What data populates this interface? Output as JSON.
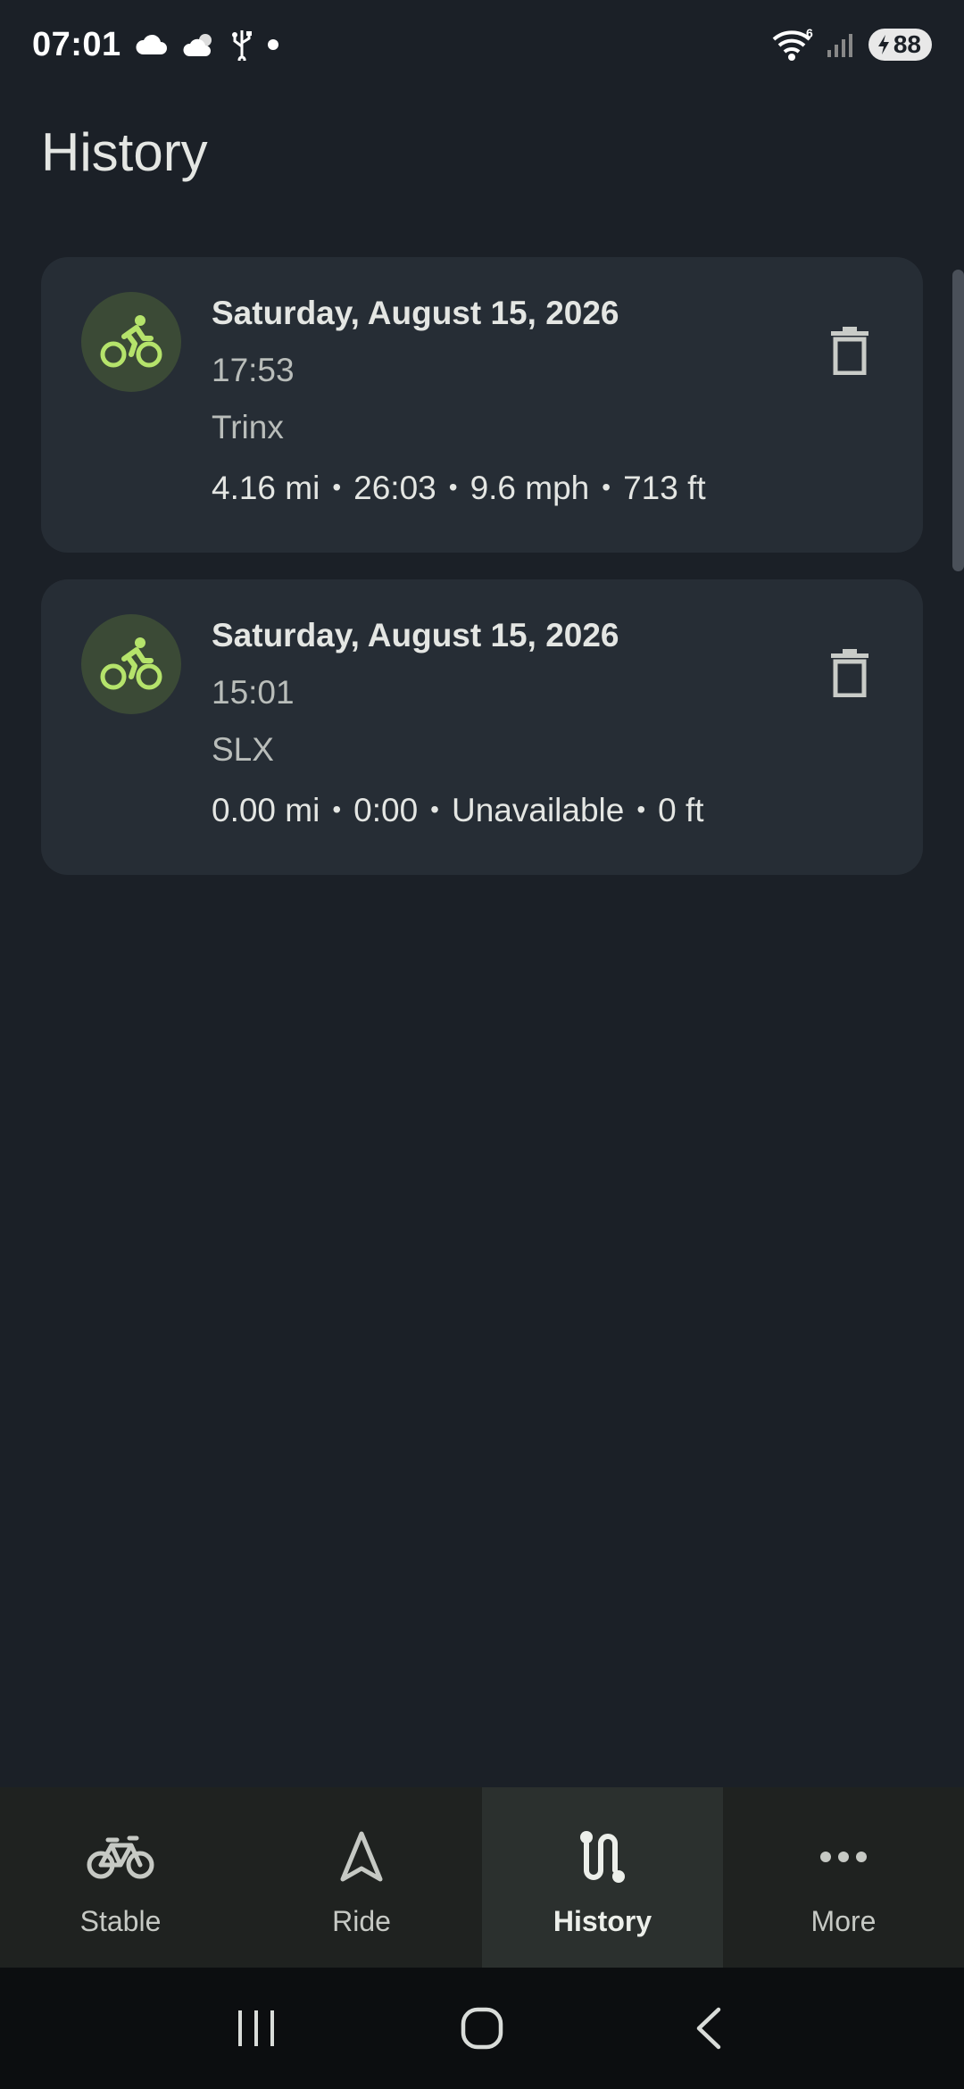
{
  "status_bar": {
    "time": "07:01",
    "battery_level": "88",
    "network_label": "6"
  },
  "header": {
    "title": "History"
  },
  "rides": [
    {
      "date": "Saturday, August 15, 2026",
      "time": "17:53",
      "bike": "Trinx",
      "distance": "4.16 mi",
      "duration": "26:03",
      "speed": "9.6 mph",
      "elevation": "713 ft"
    },
    {
      "date": "Saturday, August 15, 2026",
      "time": "15:01",
      "bike": "SLX",
      "distance": "0.00 mi",
      "duration": "0:00",
      "speed": "Unavailable",
      "elevation": "0 ft"
    }
  ],
  "nav": {
    "items": [
      {
        "label": "Stable",
        "icon": "bicycle-icon"
      },
      {
        "label": "Ride",
        "icon": "navigation-arrow-icon"
      },
      {
        "label": "History",
        "icon": "route-icon"
      },
      {
        "label": "More",
        "icon": "more-dots-icon"
      }
    ],
    "active": "History"
  },
  "colors": {
    "background": "#1b2027",
    "card": "#262d35",
    "accent": "#b5e36b",
    "avatar_bg": "#3b4a36",
    "nav_bg": "#1f2220",
    "nav_active_bg": "#2b302e"
  }
}
